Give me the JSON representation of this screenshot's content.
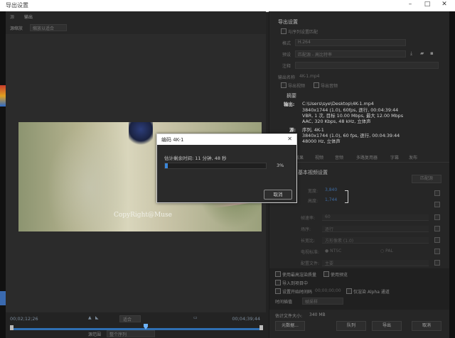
{
  "window": {
    "title": "导出设置",
    "controls": [
      "–",
      "□",
      "✕"
    ]
  },
  "left_panel": {
    "tab_source": "源",
    "tab_output": "输出",
    "tab_scale_label": "源缩放",
    "tab_scale_value": "缩放以适合",
    "watermark": "CopyRight@Muse",
    "timecode_in": "00;02;12;26",
    "timecode_out": "00;04;39;44",
    "fit_label": "适合",
    "range_label": "源范围",
    "range_value": "整个序列"
  },
  "export": {
    "heading": "导出设置",
    "match_seq": "与序列设置匹配",
    "format_label": "格式",
    "format_value": "H.264",
    "preset_label": "预设",
    "preset_value": "匹配源 - 高比特率",
    "comment_label": "注释",
    "output_name_label": "输出名称",
    "output_name_value": "4K-1.mp4",
    "export_video": "导出视频",
    "export_audio": "导出音频"
  },
  "summary": {
    "heading": "摘要",
    "output_label": "输出:",
    "output_lines": [
      "C:\\Users\\sye\\Desktop\\4K-1.mp4",
      "3840x1744 (1.0), 60fps, 逐行, 00:04:39:44",
      "VBR, 1 次, 目标 10.00 Mbps, 最大 12.00 Mbps",
      "AAC, 320 Kbps, 48 kHz, 立体声"
    ],
    "source_label": "源:",
    "source_lines": [
      "序列, 4K-1",
      "3840x1744 (1.0), 60 fps, 逐行, 00:04:39:44",
      "48000 Hz, 立体声"
    ]
  },
  "settings_tabs": [
    "效果",
    "视频",
    "音频",
    "多路复用器",
    "字幕",
    "发布"
  ],
  "video_settings": {
    "heading": "基本视频设置",
    "match_source_btn": "匹配源",
    "rows": [
      {
        "label": "宽度:",
        "value": "3,840"
      },
      {
        "label": "高度:",
        "value": "1,744"
      },
      {
        "label": "帧速率:",
        "value": "60"
      },
      {
        "label": "场序:",
        "value": "逐行"
      },
      {
        "label": "长宽比:",
        "value": "方形像素 (1.0)"
      },
      {
        "label": "电视标准:",
        "value": "NTSC"
      },
      {
        "label": "配置文件:",
        "value": "主要"
      }
    ],
    "pal_label": "PAL"
  },
  "options": {
    "max_render": "使用最高渲染质量",
    "use_preview": "使用预览",
    "import_project": "导入到项目中",
    "set_start_tc": "设置开始时间码",
    "start_tc_value": "00;00;00;00",
    "render_alpha": "仅渲染 Alpha 通道",
    "time_interp_label": "时间插值",
    "time_interp_value": "帧采样",
    "file_size_label": "估计文件大小:",
    "file_size_value": "340 MB"
  },
  "buttons": {
    "metadata": "元数据...",
    "queue": "队列",
    "export": "导出",
    "cancel": "取消"
  },
  "dialog": {
    "title": "编码 4K-1",
    "remaining": "估计剩余时间: 11 分钟, 48 秒",
    "progress": 0.03,
    "percent_text": "3%",
    "cancel": "取消"
  },
  "colors": {
    "accent": "#3b86d8",
    "panel": "#262626"
  }
}
